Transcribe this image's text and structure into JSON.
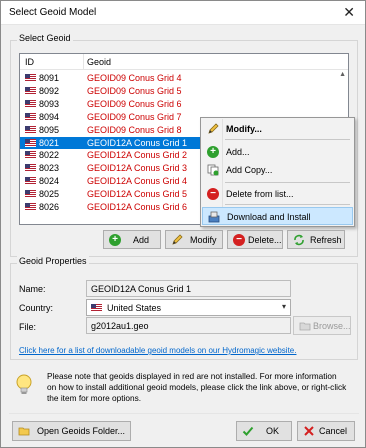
{
  "window": {
    "title": "Select Geoid Model",
    "close_glyph": "✕"
  },
  "select_group": {
    "label": "Select Geoid"
  },
  "list": {
    "columns": [
      "ID",
      "Geoid"
    ],
    "rows": [
      {
        "id": "8091",
        "name": "GEOID09 Conus Grid 4"
      },
      {
        "id": "8092",
        "name": "GEOID09 Conus Grid 5"
      },
      {
        "id": "8093",
        "name": "GEOID09 Conus Grid 6"
      },
      {
        "id": "8094",
        "name": "GEOID09 Conus Grid 7"
      },
      {
        "id": "8095",
        "name": "GEOID09 Conus Grid 8"
      },
      {
        "id": "8021",
        "name": "GEOID12A Conus Grid 1",
        "selected": true
      },
      {
        "id": "8022",
        "name": "GEOID12A Conus Grid 2"
      },
      {
        "id": "8023",
        "name": "GEOID12A Conus Grid 3"
      },
      {
        "id": "8024",
        "name": "GEOID12A Conus Grid 4"
      },
      {
        "id": "8025",
        "name": "GEOID12A Conus Grid 5"
      },
      {
        "id": "8026",
        "name": "GEOID12A Conus Grid 6"
      }
    ],
    "installed_color": "#000000",
    "not_installed_color": "#cc0000",
    "selection_color": "#0078d7"
  },
  "context_menu": {
    "items": [
      {
        "label": "Modify...",
        "icon": "pencil-icon"
      },
      {
        "label": "Add...",
        "icon": "green-plus-icon"
      },
      {
        "label": "Add Copy...",
        "icon": "copy-icon"
      },
      {
        "label": "Delete from list...",
        "icon": "red-minus-icon"
      },
      {
        "label": "Download and Install",
        "icon": "download-icon"
      }
    ]
  },
  "buttons": {
    "add": "Add",
    "modify": "Modify",
    "delete": "Delete...",
    "refresh": "Refresh"
  },
  "properties": {
    "group_label": "Geoid Properties",
    "name_label": "Name:",
    "name_value": "GEOID12A Conus Grid 1",
    "country_label": "Country:",
    "country_value": "United States",
    "file_label": "File:",
    "file_value": "g2012au1.geo",
    "browse_label": "Browse..."
  },
  "link_text": "Click here for a list of downloadable geoid models on our Hydromagic website.",
  "note": "Please note that geoids displayed in red are not installed. For more information on how to install additional geoid models, please click the link above, or right-click the item for more options.",
  "footer": {
    "open_folder": "Open Geoids Folder...",
    "ok": "OK",
    "cancel": "Cancel"
  }
}
